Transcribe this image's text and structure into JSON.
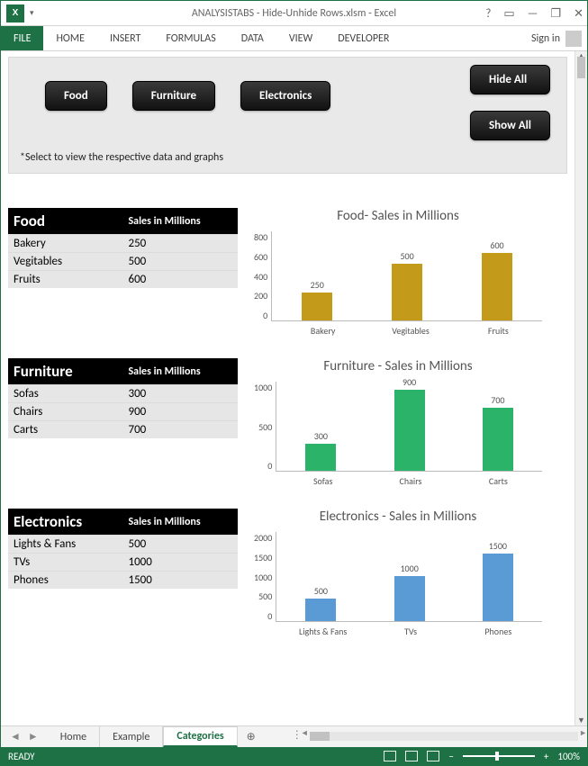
{
  "window": {
    "title": "ANALYSISTABS - Hide-Unhide Rows.xlsm - Excel",
    "help_icon": "?",
    "ribbon_opts_icon": "▭",
    "minimize_icon": "—",
    "restore_icon": "❐",
    "close_icon": "✕"
  },
  "ribbon": {
    "file": "FILE",
    "tabs": [
      "HOME",
      "INSERT",
      "FORMULAS",
      "DATA",
      "VIEW",
      "DEVELOPER"
    ],
    "signin": "Sign in"
  },
  "buttons": {
    "food": "Food",
    "furniture": "Furniture",
    "electronics": "Electronics",
    "hide_all": "Hide All",
    "show_all": "Show All"
  },
  "hint": "*Select to view the respective data and graphs",
  "tables": {
    "food": {
      "header_cat": "Food",
      "header_val": "Sales in Millions",
      "rows": [
        {
          "name": "Bakery",
          "value": "250"
        },
        {
          "name": "Vegitables",
          "value": "500"
        },
        {
          "name": "Fruits",
          "value": "600"
        }
      ]
    },
    "furniture": {
      "header_cat": "Furniture",
      "header_val": "Sales in Millions",
      "rows": [
        {
          "name": "Sofas",
          "value": "300"
        },
        {
          "name": "Chairs",
          "value": "900"
        },
        {
          "name": "Carts",
          "value": "700"
        }
      ]
    },
    "electronics": {
      "header_cat": "Electronics",
      "header_val": "Sales in Millions",
      "rows": [
        {
          "name": "Lights & Fans",
          "value": "500"
        },
        {
          "name": "TVs",
          "value": "1000"
        },
        {
          "name": "Phones",
          "value": "1500"
        }
      ]
    }
  },
  "chart_data": [
    {
      "type": "bar",
      "title": "Food- Sales in Millions",
      "categories": [
        "Bakery",
        "Vegitables",
        "Fruits"
      ],
      "values": [
        250,
        500,
        600
      ],
      "ylim": [
        0,
        800
      ],
      "yticks": [
        0,
        200,
        400,
        600,
        800
      ],
      "color": "#c49a1a"
    },
    {
      "type": "bar",
      "title": "Furniture - Sales in Millions",
      "categories": [
        "Sofas",
        "Chairs",
        "Carts"
      ],
      "values": [
        300,
        900,
        700
      ],
      "ylim": [
        0,
        1000
      ],
      "yticks": [
        0,
        500,
        1000
      ],
      "color": "#2bb36a"
    },
    {
      "type": "bar",
      "title": "Electronics - Sales in Millions",
      "categories": [
        "Lights & Fans",
        "TVs",
        "Phones"
      ],
      "values": [
        500,
        1000,
        1500
      ],
      "ylim": [
        0,
        2000
      ],
      "yticks": [
        0,
        500,
        1000,
        1500,
        2000
      ],
      "color": "#5b9bd5"
    }
  ],
  "sheets": {
    "items": [
      "Home",
      "Example",
      "Categories"
    ],
    "active": "Categories",
    "new_icon": "⊕"
  },
  "status": {
    "ready": "READY",
    "zoom": "100%",
    "minus": "−",
    "plus": "+"
  }
}
